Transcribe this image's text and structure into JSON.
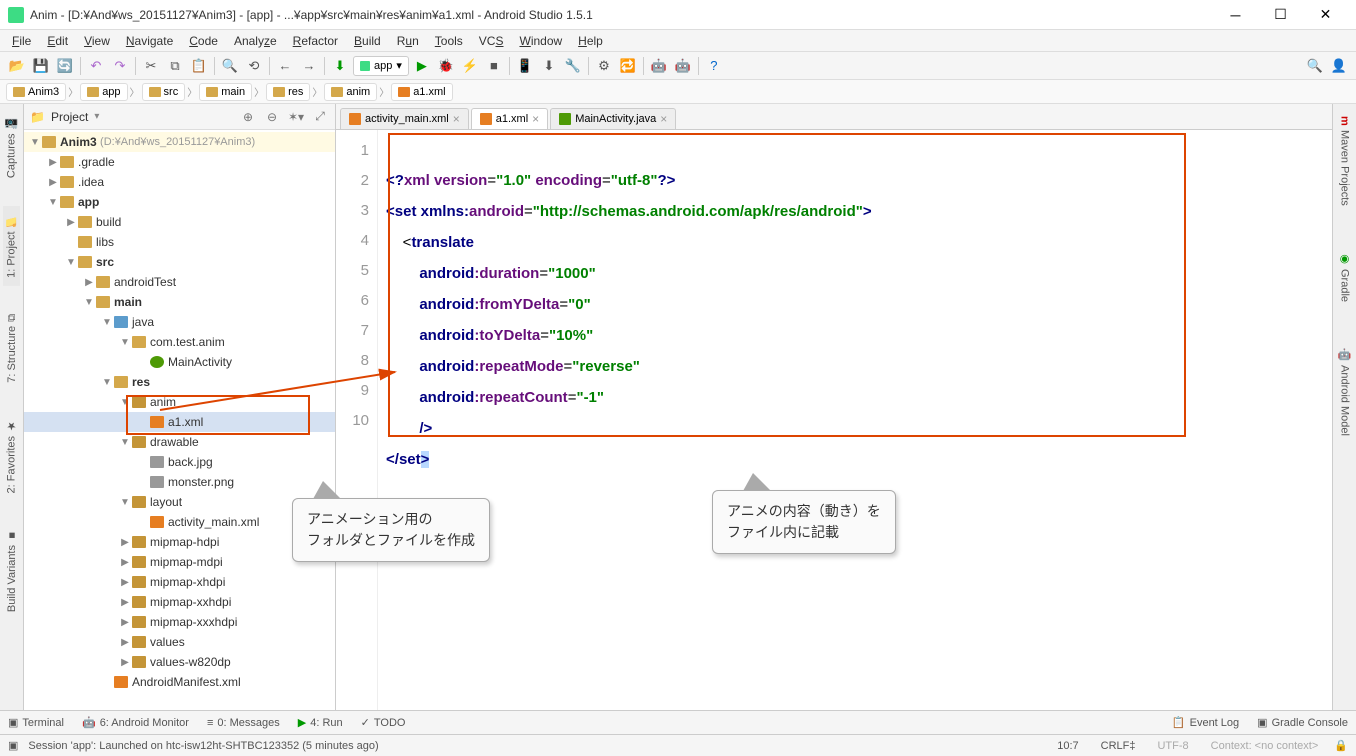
{
  "titlebar": {
    "title": "Anim - [D:¥And¥ws_20151127¥Anim3] - [app] - ...¥app¥src¥main¥res¥anim¥a1.xml - Android Studio 1.5.1"
  },
  "menu": [
    "File",
    "Edit",
    "View",
    "Navigate",
    "Code",
    "Analyze",
    "Refactor",
    "Build",
    "Run",
    "Tools",
    "VCS",
    "Window",
    "Help"
  ],
  "run_config": "app",
  "breadcrumb": [
    "Anim3",
    "app",
    "src",
    "main",
    "res",
    "anim",
    "a1.xml"
  ],
  "project": {
    "title": "Project",
    "root": "Anim3",
    "root_suffix": "(D:¥And¥ws_20151127¥Anim3)",
    "items": [
      {
        "depth": 1,
        "arrow": "▶",
        "icon": "folder",
        "label": ".gradle"
      },
      {
        "depth": 1,
        "arrow": "▶",
        "icon": "folder",
        "label": ".idea"
      },
      {
        "depth": 1,
        "arrow": "▼",
        "icon": "folder",
        "label": "app",
        "bold": true
      },
      {
        "depth": 2,
        "arrow": "▶",
        "icon": "folder",
        "label": "build"
      },
      {
        "depth": 2,
        "arrow": "",
        "icon": "folder",
        "label": "libs"
      },
      {
        "depth": 2,
        "arrow": "▼",
        "icon": "folder",
        "label": "src",
        "bold": true
      },
      {
        "depth": 3,
        "arrow": "▶",
        "icon": "folder",
        "label": "androidTest"
      },
      {
        "depth": 3,
        "arrow": "▼",
        "icon": "folder",
        "label": "main",
        "bold": true
      },
      {
        "depth": 4,
        "arrow": "▼",
        "icon": "java-pkg",
        "label": "java"
      },
      {
        "depth": 5,
        "arrow": "▼",
        "icon": "folder",
        "label": "com.test.anim"
      },
      {
        "depth": 6,
        "arrow": "",
        "icon": "clsf",
        "label": "MainActivity"
      },
      {
        "depth": 4,
        "arrow": "▼",
        "icon": "folder",
        "label": "res",
        "bold": true
      },
      {
        "depth": 5,
        "arrow": "▼",
        "icon": "folder-open",
        "label": "anim",
        "outline": true
      },
      {
        "depth": 6,
        "arrow": "",
        "icon": "xmlf",
        "label": "a1.xml",
        "selected": true,
        "outline": true
      },
      {
        "depth": 5,
        "arrow": "▼",
        "icon": "folder-open",
        "label": "drawable"
      },
      {
        "depth": 6,
        "arrow": "",
        "icon": "imgf",
        "label": "back.jpg"
      },
      {
        "depth": 6,
        "arrow": "",
        "icon": "imgf",
        "label": "monster.png"
      },
      {
        "depth": 5,
        "arrow": "▼",
        "icon": "folder-open",
        "label": "layout"
      },
      {
        "depth": 6,
        "arrow": "",
        "icon": "xmlf",
        "label": "activity_main.xml"
      },
      {
        "depth": 5,
        "arrow": "▶",
        "icon": "folder-open",
        "label": "mipmap-hdpi"
      },
      {
        "depth": 5,
        "arrow": "▶",
        "icon": "folder-open",
        "label": "mipmap-mdpi"
      },
      {
        "depth": 5,
        "arrow": "▶",
        "icon": "folder-open",
        "label": "mipmap-xhdpi"
      },
      {
        "depth": 5,
        "arrow": "▶",
        "icon": "folder-open",
        "label": "mipmap-xxhdpi"
      },
      {
        "depth": 5,
        "arrow": "▶",
        "icon": "folder-open",
        "label": "mipmap-xxxhdpi"
      },
      {
        "depth": 5,
        "arrow": "▶",
        "icon": "folder-open",
        "label": "values"
      },
      {
        "depth": 5,
        "arrow": "▶",
        "icon": "folder-open",
        "label": "values-w820dp"
      },
      {
        "depth": 4,
        "arrow": "",
        "icon": "xmlf",
        "label": "AndroidManifest.xml"
      }
    ]
  },
  "left_tabs": [
    "Captures",
    "1: Project",
    "7: Structure",
    "2: Favorites",
    "Build Variants"
  ],
  "right_tabs": [
    "Maven Projects",
    "Gradle",
    "Android Model"
  ],
  "editor_tabs": [
    {
      "label": "activity_main.xml",
      "active": false,
      "icon": "#e67e22"
    },
    {
      "label": "a1.xml",
      "active": true,
      "icon": "#e67e22"
    },
    {
      "label": "MainActivity.java",
      "active": false,
      "icon": "#4e9a06"
    }
  ],
  "code": {
    "lines": [
      1,
      2,
      3,
      4,
      5,
      6,
      7,
      8,
      9,
      10
    ],
    "l1a": "<?",
    "l1b": "xml version",
    "l1c": "=",
    "l1d": "\"1.0\"",
    "l1e": " encoding",
    "l1f": "=",
    "l1g": "\"utf-8\"",
    "l1h": "?>",
    "l2a": "<",
    "l2b": "set ",
    "l2c": "xmlns:",
    "l2d": "android",
    "l2e": "=",
    "l2f": "\"http://schemas.android.com/apk/res/android\"",
    "l2g": ">",
    "l3a": "    <",
    "l3b": "translate",
    "l4a": "        ",
    "l4b": "android",
    "l4c": ":duration",
    "l4d": "=",
    "l4e": "\"1000\"",
    "l5a": "        ",
    "l5b": "android",
    "l5c": ":fromYDelta",
    "l5d": "=",
    "l5e": "\"0\"",
    "l6a": "        ",
    "l6b": "android",
    "l6c": ":toYDelta",
    "l6d": "=",
    "l6e": "\"10%\"",
    "l7a": "        ",
    "l7b": "android",
    "l7c": ":repeatMode",
    "l7d": "=",
    "l7e": "\"reverse\"",
    "l8a": "        ",
    "l8b": "android",
    "l8c": ":repeatCount",
    "l8d": "=",
    "l8e": "\"-1\"",
    "l9a": "        />",
    "l10a": "</",
    "l10b": "set",
    "l10c": ">"
  },
  "callout1_l1": "アニメーション用の",
  "callout1_l2": "フォルダとファイルを作成",
  "callout2_l1": "アニメの内容（動き）を",
  "callout2_l2": "ファイル内に記載",
  "bottom_tools": {
    "terminal": "Terminal",
    "monitor": "6: Android Monitor",
    "messages": "0: Messages",
    "run": "4: Run",
    "todo": "TODO",
    "eventlog": "Event Log",
    "gradle": "Gradle Console"
  },
  "status": {
    "msg": "Session 'app': Launched on htc-isw12ht-SHTBC123352 (5 minutes ago)",
    "pos": "10:7",
    "crlf": "CRLF‡",
    "enc": "UTF-8",
    "context": "Context: <no context>"
  }
}
